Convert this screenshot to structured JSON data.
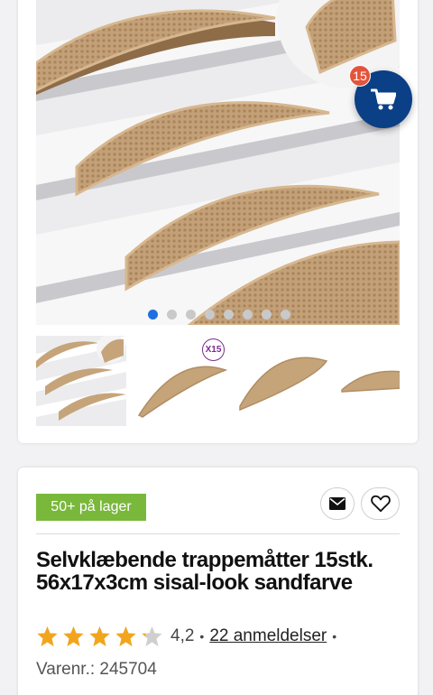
{
  "cart": {
    "count": "15",
    "icon": "cart-icon"
  },
  "gallery": {
    "active_index": 0,
    "dot_count": 8,
    "thumb_badge": "X15"
  },
  "product": {
    "stock_badge": "50+ på lager",
    "title": "Selvklæbende trappemåtter 15stk. 56x17x3cm sisal-look sandfarve",
    "rating": "4,2",
    "rating_stars": 4.2,
    "rating_max": 5,
    "separator": "•",
    "reviews": "22 anmeldelser",
    "sku": "Varenr.: 245704"
  },
  "actions": {
    "email_icon": "envelope-icon",
    "wishlist_icon": "heart-icon"
  },
  "colors": {
    "accent": "#0b3f86",
    "badge": "#e4543b",
    "stock": "#79b83b",
    "star": "#f2a51c",
    "dot_active": "#1f6fe0",
    "mat": "#c6a47a"
  }
}
